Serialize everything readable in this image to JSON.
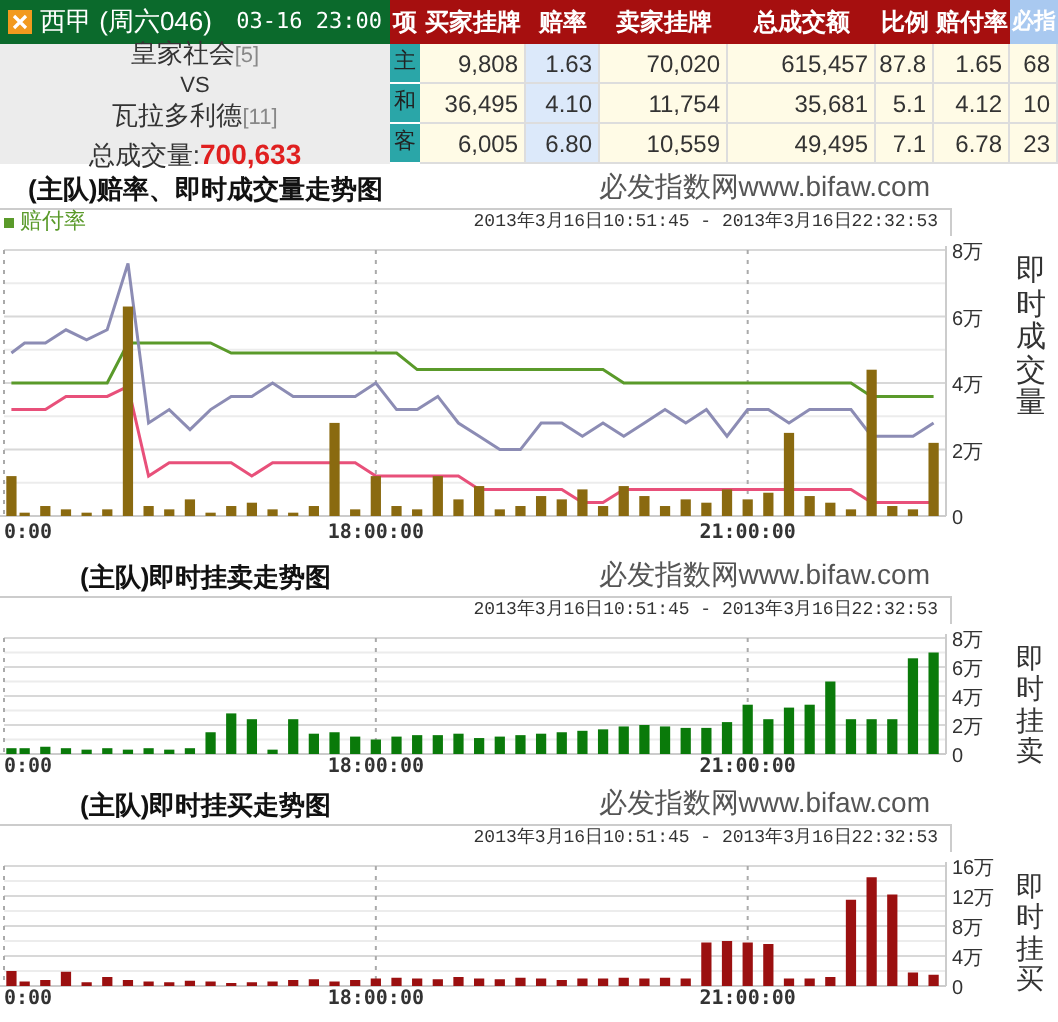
{
  "match": {
    "league": "西甲 (周六046)",
    "time": "03-16 23:00",
    "home": {
      "name": "皇家社会",
      "rank": "[5]"
    },
    "vs": "VS",
    "away": {
      "name": "瓦拉多利德",
      "rank": "[11]"
    },
    "total_label": "总成交量:",
    "total": "700,633"
  },
  "table": {
    "columns": [
      "项",
      "买家挂牌",
      "赔率",
      "卖家挂牌",
      "总成交额",
      "比例",
      "赔付率",
      "必指"
    ],
    "rows": [
      {
        "cells": [
          "主",
          "9,808",
          "1.63",
          "70,020",
          "615,457",
          "87.8",
          "1.65",
          "68"
        ]
      },
      {
        "cells": [
          "和",
          "36,495",
          "4.10",
          "11,754",
          "35,681",
          "5.1",
          "4.12",
          "10"
        ]
      },
      {
        "cells": [
          "客",
          "6,005",
          "6.80",
          "10,559",
          "49,495",
          "7.1",
          "6.78",
          "23"
        ]
      }
    ]
  },
  "charts": [
    {
      "title": "(主队)赔率、即时成交量走势图",
      "site_credit": "必发指数网www.bifaw.com",
      "date_range": "2013年3月16日10:51:45 - 2013年3月16日22:32:53",
      "chart_data": {
        "type": "line",
        "ylabel": "即时成交量",
        "grid": true,
        "x": [
          15.06,
          15.1667,
          15.3333,
          15.5,
          15.6667,
          15.8333,
          16,
          16.1667,
          16.3333,
          16.5,
          16.6667,
          16.8333,
          17,
          17.1667,
          17.3333,
          17.5,
          17.6667,
          17.8333,
          18,
          18.1667,
          18.3333,
          18.5,
          18.6667,
          18.8333,
          19,
          19.1667,
          19.3333,
          19.5,
          19.6667,
          19.8333,
          20,
          20.1667,
          20.3333,
          20.5,
          20.6667,
          20.8333,
          21,
          21.1667,
          21.3333,
          21.5,
          21.6667,
          21.8333,
          22,
          22.1667,
          22.3333,
          22.5
        ],
        "xlim": [
          15,
          22.6
        ],
        "ylim": [
          0,
          8
        ],
        "xticks": [
          {
            "value": 15,
            "label": "0:00"
          },
          {
            "value": 18,
            "label": "18:00:00"
          },
          {
            "value": 21,
            "label": "21:00:00"
          }
        ],
        "yticks": [
          {
            "value": 0,
            "label": "0"
          },
          {
            "value": 2,
            "label": "2万"
          },
          {
            "value": 4,
            "label": "4万"
          },
          {
            "value": 6,
            "label": "6万"
          },
          {
            "value": 8,
            "label": "8万"
          }
        ],
        "series": [
          {
            "name": "赔付率",
            "color": "#5a9a2a",
            "values": [
              4.0,
              4.0,
              4.0,
              4.0,
              4.0,
              4.0,
              5.2,
              5.2,
              5.2,
              5.2,
              5.2,
              4.9,
              4.9,
              4.9,
              4.9,
              4.9,
              4.9,
              4.9,
              4.9,
              4.9,
              4.4,
              4.4,
              4.4,
              4.4,
              4.4,
              4.4,
              4.4,
              4.4,
              4.4,
              4.4,
              4.0,
              4.0,
              4.0,
              4.0,
              4.0,
              4.0,
              4.0,
              4.0,
              4.0,
              4.0,
              4.0,
              4.0,
              3.6,
              3.6,
              3.6,
              3.6
            ]
          },
          {
            "color": "#8c8cb4",
            "values": [
              4.9,
              5.2,
              5.2,
              5.6,
              5.3,
              5.6,
              7.6,
              2.8,
              3.2,
              2.6,
              3.2,
              3.6,
              3.6,
              4.0,
              3.6,
              3.6,
              3.6,
              3.6,
              4.0,
              3.2,
              3.2,
              3.6,
              2.8,
              2.4,
              2.0,
              2.0,
              2.8,
              2.8,
              2.4,
              2.8,
              2.4,
              2.8,
              3.2,
              2.8,
              3.2,
              2.4,
              3.2,
              3.2,
              2.8,
              3.2,
              3.2,
              3.2,
              2.4,
              2.4,
              2.4,
              2.8
            ]
          },
          {
            "color": "#e8507a",
            "values": [
              3.2,
              3.2,
              3.2,
              3.6,
              3.6,
              3.6,
              3.9,
              1.2,
              1.6,
              1.6,
              1.6,
              1.6,
              1.2,
              1.6,
              1.6,
              1.6,
              1.6,
              1.6,
              1.2,
              1.2,
              1.2,
              1.2,
              1.2,
              0.8,
              0.8,
              0.8,
              0.8,
              0.8,
              0.4,
              0.4,
              0.8,
              0.8,
              0.8,
              0.8,
              0.8,
              0.8,
              0.8,
              0.8,
              0.8,
              0.8,
              0.8,
              0.8,
              0.4,
              0.4,
              0.4,
              0.4
            ]
          },
          {
            "type": "bar",
            "color": "#8a6a10",
            "values": [
              1.2,
              0.1,
              0.3,
              0.2,
              0.1,
              0.2,
              6.3,
              0.3,
              0.2,
              0.5,
              0.1,
              0.3,
              0.4,
              0.2,
              0.1,
              0.3,
              2.8,
              0.2,
              1.2,
              0.3,
              0.2,
              1.2,
              0.5,
              0.9,
              0.2,
              0.3,
              0.6,
              0.5,
              0.8,
              0.3,
              0.9,
              0.6,
              0.3,
              0.5,
              0.4,
              0.8,
              0.5,
              0.7,
              2.5,
              0.6,
              0.4,
              0.2,
              4.4,
              0.3,
              0.2,
              2.2
            ]
          }
        ]
      }
    },
    {
      "title": "(主队)即时挂卖走势图",
      "site_credit": "必发指数网www.bifaw.com",
      "date_range": "2013年3月16日10:51:45 - 2013年3月16日22:32:53",
      "chart_data": {
        "type": "bar",
        "ylabel": "即时挂卖",
        "grid": true,
        "x": [
          15.06,
          15.1667,
          15.3333,
          15.5,
          15.6667,
          15.8333,
          16,
          16.1667,
          16.3333,
          16.5,
          16.6667,
          16.8333,
          17,
          17.1667,
          17.3333,
          17.5,
          17.6667,
          17.8333,
          18,
          18.1667,
          18.3333,
          18.5,
          18.6667,
          18.8333,
          19,
          19.1667,
          19.3333,
          19.5,
          19.6667,
          19.8333,
          20,
          20.1667,
          20.3333,
          20.5,
          20.6667,
          20.8333,
          21,
          21.1667,
          21.3333,
          21.5,
          21.6667,
          21.8333,
          22,
          22.1667,
          22.3333,
          22.5
        ],
        "xlim": [
          15,
          22.6
        ],
        "ylim": [
          0,
          8
        ],
        "xticks": [
          {
            "value": 15,
            "label": "0:00"
          },
          {
            "value": 18,
            "label": "18:00:00"
          },
          {
            "value": 21,
            "label": "21:00:00"
          }
        ],
        "yticks": [
          {
            "value": 0,
            "label": "0"
          },
          {
            "value": 2,
            "label": "2万"
          },
          {
            "value": 4,
            "label": "4万"
          },
          {
            "value": 6,
            "label": "6万"
          },
          {
            "value": 8,
            "label": "8万"
          }
        ],
        "series": [
          {
            "color": "#0a7a0a",
            "values": [
              0.4,
              0.4,
              0.5,
              0.4,
              0.3,
              0.4,
              0.3,
              0.4,
              0.3,
              0.4,
              1.5,
              2.8,
              2.4,
              0.3,
              2.4,
              1.4,
              1.5,
              1.2,
              1.0,
              1.2,
              1.3,
              1.3,
              1.4,
              1.1,
              1.2,
              1.3,
              1.4,
              1.5,
              1.6,
              1.7,
              1.9,
              2.0,
              1.9,
              1.8,
              1.8,
              2.2,
              3.4,
              2.4,
              3.2,
              3.4,
              5.0,
              2.4,
              2.4,
              2.4,
              6.6,
              7.0
            ]
          }
        ]
      }
    },
    {
      "title": "(主队)即时挂买走势图",
      "site_credit": "必发指数网www.bifaw.com",
      "date_range": "2013年3月16日10:51:45 - 2013年3月16日22:32:53",
      "chart_data": {
        "type": "bar",
        "ylabel": "即时挂买",
        "grid": true,
        "x": [
          15.06,
          15.1667,
          15.3333,
          15.5,
          15.6667,
          15.8333,
          16,
          16.1667,
          16.3333,
          16.5,
          16.6667,
          16.8333,
          17,
          17.1667,
          17.3333,
          17.5,
          17.6667,
          17.8333,
          18,
          18.1667,
          18.3333,
          18.5,
          18.6667,
          18.8333,
          19,
          19.1667,
          19.3333,
          19.5,
          19.6667,
          19.8333,
          20,
          20.1667,
          20.3333,
          20.5,
          20.6667,
          20.8333,
          21,
          21.1667,
          21.3333,
          21.5,
          21.6667,
          21.8333,
          22,
          22.1667,
          22.3333,
          22.5
        ],
        "xlim": [
          15,
          22.6
        ],
        "ylim": [
          0,
          16
        ],
        "xticks": [
          {
            "value": 15,
            "label": "0:00"
          },
          {
            "value": 18,
            "label": "18:00:00"
          },
          {
            "value": 21,
            "label": "21:00:00"
          }
        ],
        "yticks": [
          {
            "value": 0,
            "label": "0"
          },
          {
            "value": 4,
            "label": "4万"
          },
          {
            "value": 8,
            "label": "8万"
          },
          {
            "value": 12,
            "label": "12万"
          },
          {
            "value": 16,
            "label": "16万"
          }
        ],
        "series": [
          {
            "color": "#9b1010",
            "values": [
              2.0,
              0.6,
              0.8,
              1.9,
              0.5,
              1.2,
              0.8,
              0.6,
              0.5,
              0.7,
              0.6,
              0.4,
              0.5,
              0.6,
              0.8,
              0.9,
              0.6,
              0.8,
              1.0,
              1.1,
              1.0,
              0.9,
              1.2,
              1.0,
              0.9,
              1.1,
              1.0,
              0.8,
              1.0,
              1.0,
              1.1,
              1.0,
              1.1,
              1.0,
              5.8,
              6.0,
              5.8,
              5.6,
              1.0,
              1.0,
              1.2,
              11.5,
              14.5,
              12.2,
              1.8,
              1.5
            ]
          }
        ]
      }
    }
  ]
}
